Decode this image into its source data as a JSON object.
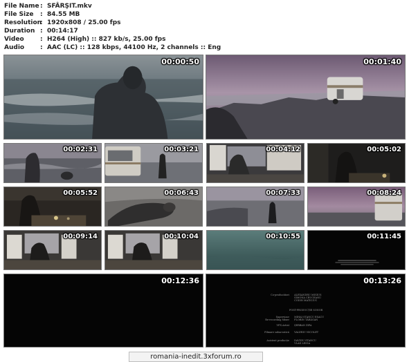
{
  "file_info": [
    {
      "label": "File Name",
      "value": "SFÂRŞIT.mkv"
    },
    {
      "label": "File Size",
      "value": "84.55 MB"
    },
    {
      "label": "Resolution",
      "value": "1920x808 / 25.00 fps"
    },
    {
      "label": "Duration",
      "value": "00:14:17"
    },
    {
      "label": "Video",
      "value": "H264 (High) :: 827 kb/s, 25.00 fps"
    },
    {
      "label": "Audio",
      "value": "AAC (LC) :: 128 kbps, 44100 Hz, 2 channels :: Eng"
    }
  ],
  "separator": ":",
  "thumbnails": [
    {
      "time": "00:00:50",
      "scene": "man-at-sea"
    },
    {
      "time": "00:01:40",
      "scene": "caravan-on-rocks"
    },
    {
      "time": "00:02:31",
      "scene": "man-on-shore"
    },
    {
      "time": "00:03:21",
      "scene": "caravan-and-figure"
    },
    {
      "time": "00:04:12",
      "scene": "man-in-caravan-window"
    },
    {
      "time": "00:05:02",
      "scene": "dark-interior"
    },
    {
      "time": "00:05:52",
      "scene": "interior-table"
    },
    {
      "time": "00:06:43",
      "scene": "man-lying-on-ground"
    },
    {
      "time": "00:07:33",
      "scene": "figure-on-coast"
    },
    {
      "time": "00:08:24",
      "scene": "caravan-dusk"
    },
    {
      "time": "00:09:14",
      "scene": "man-at-window-table"
    },
    {
      "time": "00:10:04",
      "scene": "man-at-window-table-2"
    },
    {
      "time": "00:10:55",
      "scene": "sea-teal"
    },
    {
      "time": "00:11:45",
      "scene": "black-text"
    },
    {
      "time": "00:12:36",
      "scene": "black"
    },
    {
      "time": "00:13:26",
      "scene": "credits"
    }
  ],
  "credits": [
    {
      "role": "Co-producători",
      "names": "ALEXANDRU MIGIUS\nSIMONA CRUCEANU\nCODIN MATICIUC"
    },
    {
      "role": "",
      "names": "POST-PRODUCȚIE SONOR"
    },
    {
      "role": "Supervizor\nRe-recording Mixer",
      "names": "MIHAI STANCU ESACU\nFLORIN TĂRĂGAN"
    },
    {
      "role": "VFX Artist",
      "names": "ȘERBAN ZIPA"
    },
    {
      "role": "Filmare subacvatică",
      "names": "VALERIU NICOLET"
    },
    {
      "role": "Asistent producție",
      "names": "DAVIDU STANCU\nVLAD LEIGA"
    }
  ],
  "watermark": "romania-inedit.3xforum.ro",
  "colors": {
    "timestamp": "#ffffff",
    "background": "#ffffff",
    "info_text": "#222222"
  }
}
